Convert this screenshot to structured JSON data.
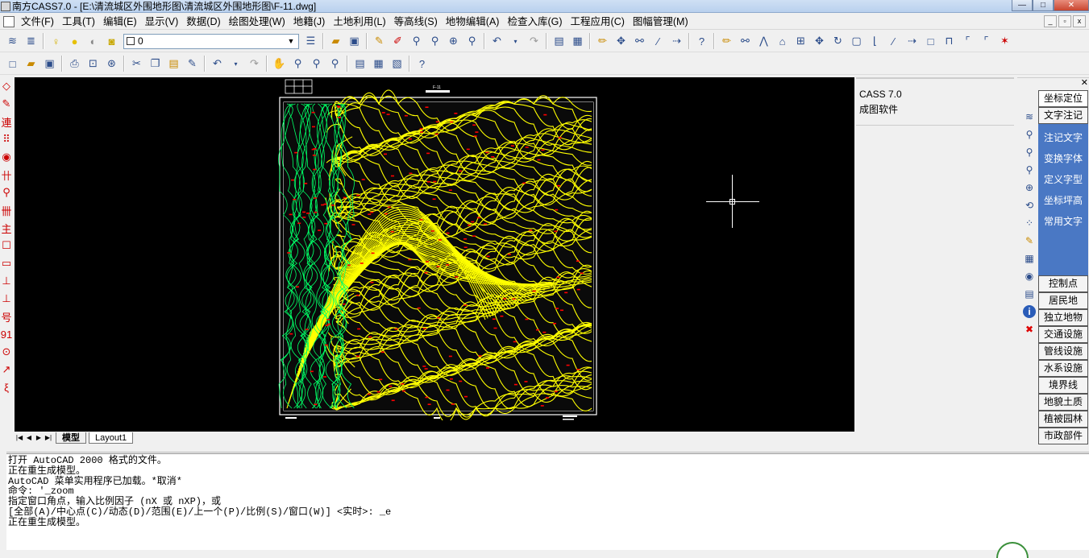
{
  "window": {
    "title": "南方CASS7.0 - [E:\\清流城区外围地形图\\清流城区外围地形图\\F-11.dwg]",
    "min_label": "—",
    "max_label": "□",
    "close_label": "✕"
  },
  "menu": [
    "文件(F)",
    "工具(T)",
    "编辑(E)",
    "显示(V)",
    "数据(D)",
    "绘图处理(W)",
    "地籍(J)",
    "土地利用(L)",
    "等高线(S)",
    "地物编辑(A)",
    "检查入库(G)",
    "工程应用(C)",
    "图幅管理(M)"
  ],
  "mdi_buttons": [
    "_",
    "▫",
    "x"
  ],
  "toolbar1": {
    "layer_value": "0",
    "icons_left": [
      "layers-icon",
      "layer-states-icon"
    ],
    "icons_lamp": [
      "lightbulb-icon",
      "sun-icon",
      "lock-icon",
      "color-icon"
    ],
    "icons_right": [
      "linetype-icon",
      "open-icon",
      "save-icon",
      "pencil-icon",
      "draw-icon",
      "zoom-realtime-icon",
      "zoom-window-icon",
      "zoom-in-icon",
      "zoom-previous-icon",
      "undo-icon",
      "redo-icon",
      "properties-icon",
      "table-icon",
      "edit-icon",
      "move-icon",
      "scale-icon",
      "break-icon",
      "extend-icon",
      "help-icon",
      "edit2-icon",
      "scale2-icon",
      "mirror-icon",
      "offset-icon",
      "array-icon",
      "move2-icon",
      "rotate-icon",
      "stretch-icon",
      "trim-icon",
      "extend2-icon",
      "extend3-icon",
      "rect-icon",
      "rect2-icon",
      "chamfer-icon",
      "fillet-icon",
      "explode-icon"
    ]
  },
  "toolbar2": {
    "icons": [
      "new-icon",
      "open-icon",
      "save-icon",
      "print-icon",
      "preview-icon",
      "publish-icon",
      "cut-icon",
      "copy-icon",
      "paste-icon",
      "matchprop-icon",
      "undo-icon",
      "redo-icon",
      "pan-icon",
      "zoom-realtime-icon",
      "zoom-window-icon",
      "zoom-previous-icon",
      "properties-icon",
      "designcenter-icon",
      "toolpalette-icon",
      "help-icon"
    ]
  },
  "left_toolbar": [
    "◇",
    "✎",
    "連",
    "⠿",
    "◉",
    "卄",
    "⚲",
    "卌",
    "主",
    "☐",
    "▭",
    "⊥",
    "⊥",
    "号",
    "91",
    "⊙",
    "↗",
    "ξ"
  ],
  "canvas": {
    "background": "#000000",
    "drawing_id": "F-11",
    "contour_color": "#ffff00",
    "green_color": "#00ff66",
    "red_color": "#ff0000"
  },
  "tabs": {
    "nav": [
      "|◀",
      "◀",
      "▶",
      "▶|"
    ],
    "items": [
      "模型",
      "Layout1"
    ]
  },
  "properties": {
    "line1": "CASS 7.0",
    "line2": "成图软件"
  },
  "right_panel": {
    "top_button": "坐标定位",
    "text_button": "文字注记",
    "sub_items": [
      "注记文字",
      "变换字体",
      "定义字型",
      "坐标坪高",
      "常用文字"
    ],
    "buttons": [
      "控制点",
      "居民地",
      "独立地物",
      "交通设施",
      "管线设施",
      "水系设施",
      "境界线",
      "地貌土质",
      "植被园林",
      "市政部件"
    ],
    "close_label": "✕",
    "icons": [
      "layers-icon",
      "zoom-icon",
      "zoom2-icon",
      "zoom3-icon",
      "zoom4-icon",
      "pan-icon",
      "array-icon",
      "pencil-icon",
      "grid-icon",
      "find-icon",
      "list-icon",
      "info-icon",
      "delete-icon"
    ]
  },
  "command": {
    "lines": [
      "打开 AutoCAD 2000 格式的文件。",
      "正在重生成模型。",
      "AutoCAD 菜单实用程序已加载。*取消*",
      "命令: '_zoom",
      "指定窗口角点，输入比例因子 (nX 或 nXP)，或",
      "[全部(A)/中心点(C)/动态(D)/范围(E)/上一个(P)/比例(S)/窗口(W)] <实时>: _e",
      "正在重生成模型。"
    ]
  }
}
